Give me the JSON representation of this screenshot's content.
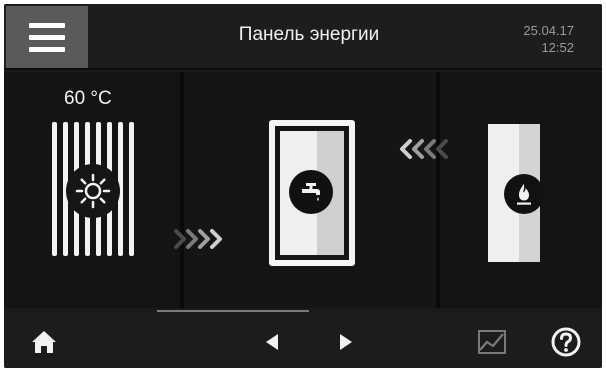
{
  "header": {
    "menu_icon": "hamburger-menu-icon",
    "title": "Панель энергии",
    "date": "25.04.17",
    "time": "12:52"
  },
  "panels": {
    "radiator": {
      "temperature": "60 °C",
      "icon": "sun-icon"
    },
    "storage": {
      "icon": "water-tap-icon"
    },
    "heater": {
      "icon": "gas-flame-icon"
    }
  },
  "flow_arrows": {
    "left_to_mid": "»»»",
    "right_to_mid": "«««"
  },
  "footer": {
    "home_icon": "home-icon",
    "prev_icon": "arrow-left-icon",
    "next_icon": "arrow-right-icon",
    "chart_icon": "chart-icon",
    "help_icon": "help-icon"
  },
  "colors": {
    "background": "#1a1a1a",
    "menu_button": "#5a5a5a",
    "datetime": "#9a9a9a",
    "icon_light": "#f2f2f2",
    "icon_gray": "#7a7a7a"
  }
}
